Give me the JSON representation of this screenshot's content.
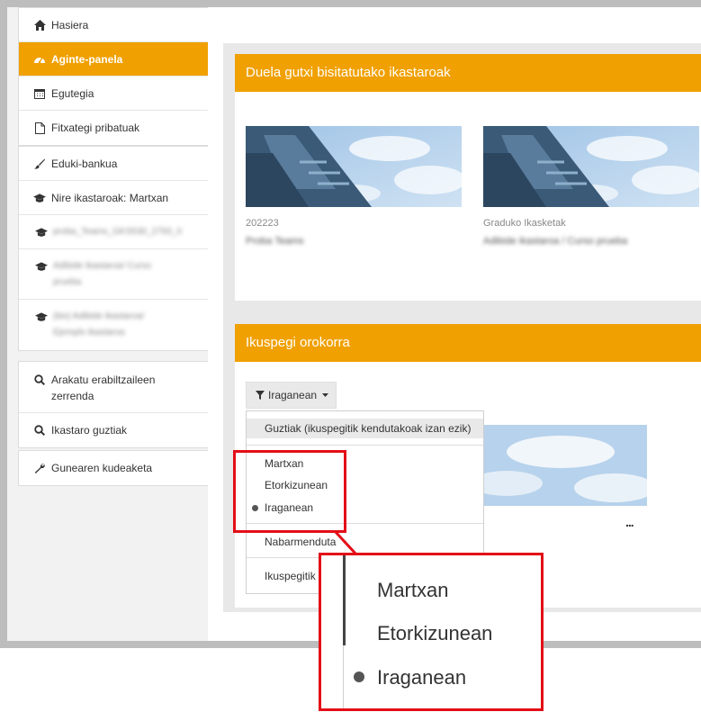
{
  "sidebar": {
    "items": [
      {
        "label": "Hasiera",
        "icon": "home-icon"
      },
      {
        "label": "Aginte-panela",
        "icon": "dashboard-icon",
        "active": true
      },
      {
        "label": "Egutegia",
        "icon": "calendar-icon"
      },
      {
        "label": "Fitxategi pribatuak",
        "icon": "file-icon"
      },
      {
        "label": "Eduki-bankua",
        "icon": "paint-brush-icon"
      },
      {
        "label": "Nire ikastaroak: Martxan",
        "icon": "graduation-cap-icon"
      }
    ],
    "courses": [
      {
        "label": "proba_Teams_GKS530_2793_0",
        "icon": "graduation-cap-icon"
      },
      {
        "label": "Adibide ikastaroa/ Curso prueba",
        "icon": "graduation-cap-icon"
      },
      {
        "label": "(bis) Adibide ikastaroa/ Ejemplo ikastaroa",
        "icon": "graduation-cap-icon"
      }
    ],
    "group2": [
      {
        "label": "Arakatu erabiltzaileen zerrenda",
        "icon": "search-icon"
      },
      {
        "label": "Ikastaro guztiak",
        "icon": "search-icon"
      }
    ],
    "group3": [
      {
        "label": "Gunearen kudeaketa",
        "icon": "wrench-icon"
      }
    ],
    "accent": "#f0a000"
  },
  "recent": {
    "title": "Duela gutxi bisitatutako ikastaroak",
    "courses": [
      {
        "category": "202223",
        "name": "Proba Teams"
      },
      {
        "category": "Graduko Ikasketak",
        "name": "Adibide ikastaroa / Curso prueba"
      }
    ]
  },
  "overview": {
    "title": "Ikuspegi orokorra",
    "filter_label": "Iraganean",
    "options": {
      "all": "Guztiak (ikuspegitik kendutakoak izan ezik)",
      "inprogress": "Martxan",
      "future": "Etorkizunean",
      "past": "Iraganean",
      "starred": "Nabarmenduta",
      "hidden": "Ikuspegitik"
    },
    "more": "..."
  },
  "zoom": {
    "items": [
      "Martxan",
      "Etorkizunean",
      "Iraganean"
    ]
  }
}
